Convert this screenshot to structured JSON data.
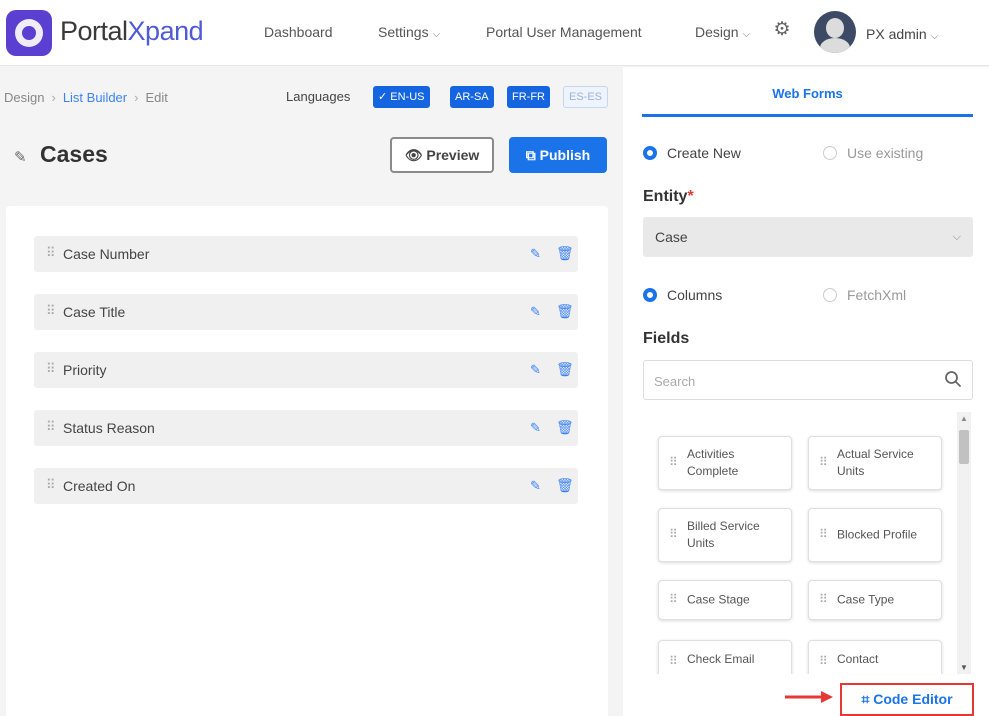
{
  "brand": {
    "name_part1": "Portal",
    "name_part2": "Xpand"
  },
  "nav": {
    "dashboard": "Dashboard",
    "settings": "Settings",
    "portal_user_management": "Portal User Management",
    "design": "Design",
    "user_name": "PX admin"
  },
  "breadcrumb": {
    "design": "Design",
    "list_builder": "List Builder",
    "edit": "Edit"
  },
  "languages": {
    "label": "Languages",
    "chips": [
      "✓ EN-US",
      "AR-SA",
      "FR-FR",
      "ES-ES"
    ]
  },
  "page": {
    "title": "Cases",
    "preview_label": "Preview",
    "publish_label": "Publish"
  },
  "columns": [
    "Case Number",
    "Case Title",
    "Priority",
    "Status Reason",
    "Created On"
  ],
  "right_panel": {
    "tab": "Web Forms",
    "create_new": "Create New",
    "use_existing": "Use existing",
    "entity_label": "Entity",
    "entity_required": "*",
    "entity_value": "Case",
    "mode_columns": "Columns",
    "mode_fetchxml": "FetchXml",
    "fields_label": "Fields",
    "search_placeholder": "Search",
    "fields": [
      "Activities Complete",
      "Actual Service Units",
      "Billed Service Units",
      "Blocked Profile",
      "Case Stage",
      "Case Type",
      "Check Email",
      "Contact"
    ],
    "code_editor": "Code Editor"
  },
  "colors": {
    "accent": "#1a73e8",
    "brand": "#5b3fd0",
    "highlight": "#e53935"
  },
  "icons": [
    "logo-icon",
    "gear-icon",
    "avatar",
    "pencil-icon",
    "eye-icon",
    "external-link-icon",
    "drag-handle-icon",
    "edit-icon",
    "trash-icon",
    "chevron-down-icon",
    "search-icon",
    "code-icon",
    "arrow-right-icon"
  ]
}
